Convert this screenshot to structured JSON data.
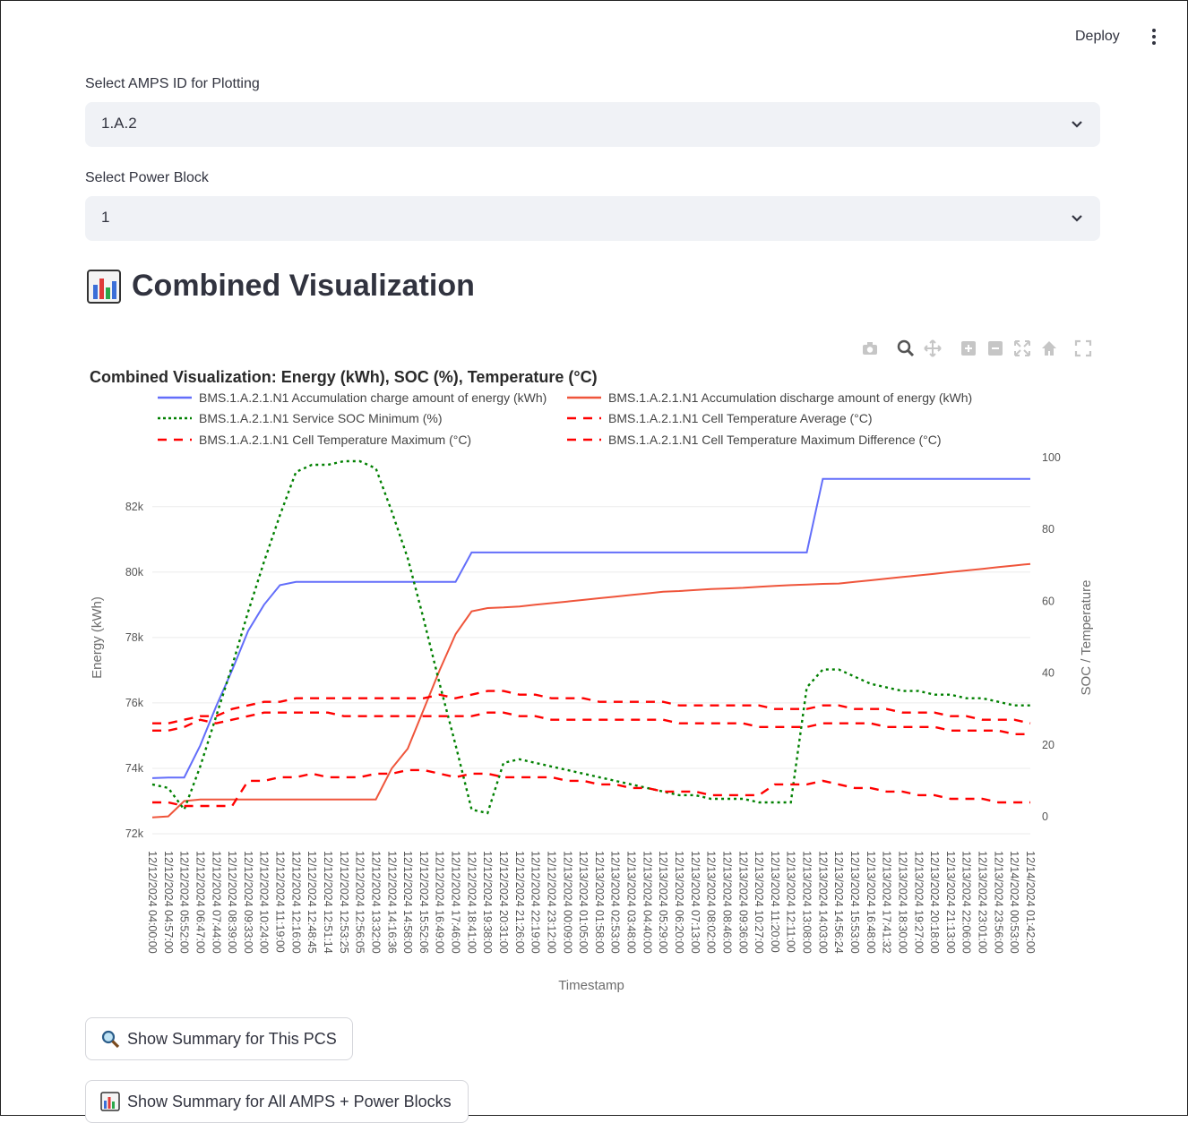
{
  "header": {
    "deploy_label": "Deploy",
    "menu_icon": "kebab-menu-icon"
  },
  "controls": {
    "amps_label": "Select AMPS ID for Plotting",
    "amps_value": "1.A.2",
    "power_block_label": "Select Power Block",
    "power_block_value": "1"
  },
  "section": {
    "icon": "bar-chart-icon",
    "title": "Combined Visualization"
  },
  "modebar": [
    "camera-icon",
    "zoom-icon",
    "pan-icon",
    "zoom-in-icon",
    "zoom-out-icon",
    "autoscale-icon",
    "home-icon",
    "fullscreen-icon"
  ],
  "buttons": {
    "summary_pcs": "Show Summary for This PCS",
    "summary_all": "Show Summary for All AMPS + Power Blocks"
  },
  "chart_data": {
    "type": "line",
    "title": "Combined Visualization: Energy (kWh), SOC (%), Temperature (°C)",
    "xlabel": "Timestamp",
    "ylabel": "Energy (kWh)",
    "y2label": "SOC / Temperature",
    "ylim": [
      72000,
      83500
    ],
    "y2lim": [
      0,
      100
    ],
    "yticks": [
      "72k",
      "74k",
      "76k",
      "78k",
      "80k",
      "82k"
    ],
    "y2ticks": [
      "0",
      "20",
      "40",
      "60",
      "80",
      "100"
    ],
    "legend_placement": "top",
    "grid": true,
    "x": [
      "12/12/2024 04:00:00",
      "12/12/2024 04:57:00",
      "12/12/2024 05:52:00",
      "12/12/2024 06:47:00",
      "12/12/2024 07:44:00",
      "12/12/2024 08:39:00",
      "12/12/2024 09:33:00",
      "12/12/2024 10:24:00",
      "12/12/2024 11:19:00",
      "12/12/2024 12:16:00",
      "12/12/2024 12:48:45",
      "12/12/2024 12:51:14",
      "12/12/2024 12:53:25",
      "12/12/2024 12:56:05",
      "12/12/2024 13:32:00",
      "12/12/2024 14:16:36",
      "12/12/2024 14:58:00",
      "12/12/2024 15:52:06",
      "12/12/2024 16:49:00",
      "12/12/2024 17:46:00",
      "12/12/2024 18:41:00",
      "12/12/2024 19:38:00",
      "12/12/2024 20:31:00",
      "12/12/2024 21:26:00",
      "12/12/2024 22:19:00",
      "12/12/2024 23:12:00",
      "12/13/2024 00:09:00",
      "12/13/2024 01:05:00",
      "12/13/2024 01:58:00",
      "12/13/2024 02:53:00",
      "12/13/2024 03:48:00",
      "12/13/2024 04:40:00",
      "12/13/2024 05:29:00",
      "12/13/2024 06:20:00",
      "12/13/2024 07:13:00",
      "12/13/2024 08:02:00",
      "12/13/2024 08:46:00",
      "12/13/2024 09:36:00",
      "12/13/2024 10:27:00",
      "12/13/2024 11:20:00",
      "12/13/2024 12:11:00",
      "12/13/2024 13:08:00",
      "12/13/2024 14:03:00",
      "12/13/2024 14:56:24",
      "12/13/2024 15:53:00",
      "12/13/2024 16:48:00",
      "12/13/2024 17:41:32",
      "12/13/2024 18:30:00",
      "12/13/2024 19:27:00",
      "12/13/2024 20:18:00",
      "12/13/2024 21:13:00",
      "12/13/2024 22:06:00",
      "12/13/2024 23:01:00",
      "12/13/2024 23:56:00",
      "12/14/2024 00:53:00",
      "12/14/2024 01:42:00"
    ],
    "series": [
      {
        "name": "BMS.1.A.2.1.N1 Accumulation charge amount of energy (kWh)",
        "axis": "y",
        "color": "#636efa",
        "dash": "solid",
        "values": [
          73700,
          73720,
          73720,
          74700,
          75900,
          77000,
          78200,
          79000,
          79600,
          79700,
          79700,
          79700,
          79700,
          79700,
          79700,
          79700,
          79700,
          79700,
          79700,
          79700,
          80600,
          80600,
          80600,
          80600,
          80600,
          80600,
          80600,
          80600,
          80600,
          80600,
          80600,
          80600,
          80600,
          80600,
          80600,
          80600,
          80600,
          80600,
          80600,
          80600,
          80600,
          80600,
          82850,
          82850,
          82850,
          82850,
          82850,
          82850,
          82850,
          82850,
          82850,
          82850,
          82850,
          82850,
          82850,
          82850
        ]
      },
      {
        "name": "BMS.1.A.2.1.N1 Accumulation discharge amount of energy (kWh)",
        "axis": "y",
        "color": "#ef553b",
        "dash": "solid",
        "values": [
          72500,
          72530,
          73000,
          73050,
          73050,
          73050,
          73050,
          73050,
          73050,
          73050,
          73050,
          73050,
          73050,
          73050,
          73050,
          74000,
          74600,
          75800,
          77000,
          78100,
          78800,
          78900,
          78920,
          78950,
          79000,
          79050,
          79100,
          79150,
          79200,
          79250,
          79300,
          79350,
          79400,
          79420,
          79450,
          79480,
          79500,
          79520,
          79550,
          79580,
          79600,
          79620,
          79640,
          79650,
          79700,
          79750,
          79800,
          79850,
          79900,
          79950,
          80000,
          80050,
          80100,
          80150,
          80200,
          80250
        ]
      },
      {
        "name": "BMS.1.A.2.1.N1 Service SOC Minimum (%)",
        "axis": "y2",
        "color": "green",
        "dash": "dot",
        "values": [
          9,
          8,
          2,
          14,
          28,
          42,
          57,
          71,
          84,
          96,
          98,
          98,
          99,
          99,
          97,
          85,
          72,
          55,
          37,
          20,
          2,
          1,
          15,
          16,
          15,
          14,
          13,
          12,
          11,
          10,
          9,
          8,
          7,
          6,
          6,
          5,
          5,
          5,
          4,
          4,
          4,
          36,
          41,
          41,
          39,
          37,
          36,
          35,
          35,
          34,
          34,
          33,
          33,
          32,
          31,
          31
        ]
      },
      {
        "name": "BMS.1.A.2.1.N1 Cell Temperature Average (°C)",
        "axis": "y2",
        "color": "red",
        "dash": "dash",
        "values": [
          24,
          24,
          25,
          27,
          26,
          27,
          28,
          29,
          29,
          29,
          29,
          29,
          28,
          28,
          28,
          28,
          28,
          28,
          28,
          28,
          28,
          29,
          29,
          28,
          28,
          27,
          27,
          27,
          27,
          27,
          27,
          27,
          27,
          26,
          26,
          26,
          26,
          26,
          25,
          25,
          25,
          25,
          26,
          26,
          26,
          26,
          25,
          25,
          25,
          25,
          24,
          24,
          24,
          24,
          23,
          23
        ]
      },
      {
        "name": "BMS.1.A.2.1.N1 Cell Temperature Maximum (°C)",
        "axis": "y2",
        "color": "red",
        "dash": "dash",
        "values": [
          26,
          26,
          27,
          28,
          28,
          30,
          31,
          32,
          32,
          33,
          33,
          33,
          33,
          33,
          33,
          33,
          33,
          33,
          34,
          33,
          34,
          35,
          35,
          34,
          34,
          33,
          33,
          33,
          32,
          32,
          32,
          32,
          32,
          31,
          31,
          31,
          31,
          31,
          31,
          30,
          30,
          30,
          31,
          31,
          30,
          30,
          30,
          29,
          29,
          29,
          28,
          28,
          27,
          27,
          27,
          26
        ]
      },
      {
        "name": "BMS.1.A.2.1.N1 Cell Temperature Maximum Difference (°C)",
        "axis": "y2",
        "color": "red",
        "dash": "dash",
        "values": [
          4,
          4,
          3,
          3,
          3,
          3,
          10,
          10,
          11,
          11,
          12,
          11,
          11,
          11,
          12,
          12,
          13,
          13,
          12,
          11,
          12,
          12,
          11,
          11,
          11,
          11,
          10,
          10,
          9,
          9,
          8,
          8,
          7,
          7,
          7,
          6,
          6,
          6,
          6,
          9,
          9,
          9,
          10,
          9,
          8,
          8,
          7,
          7,
          6,
          6,
          5,
          5,
          5,
          4,
          4,
          4
        ]
      }
    ]
  }
}
